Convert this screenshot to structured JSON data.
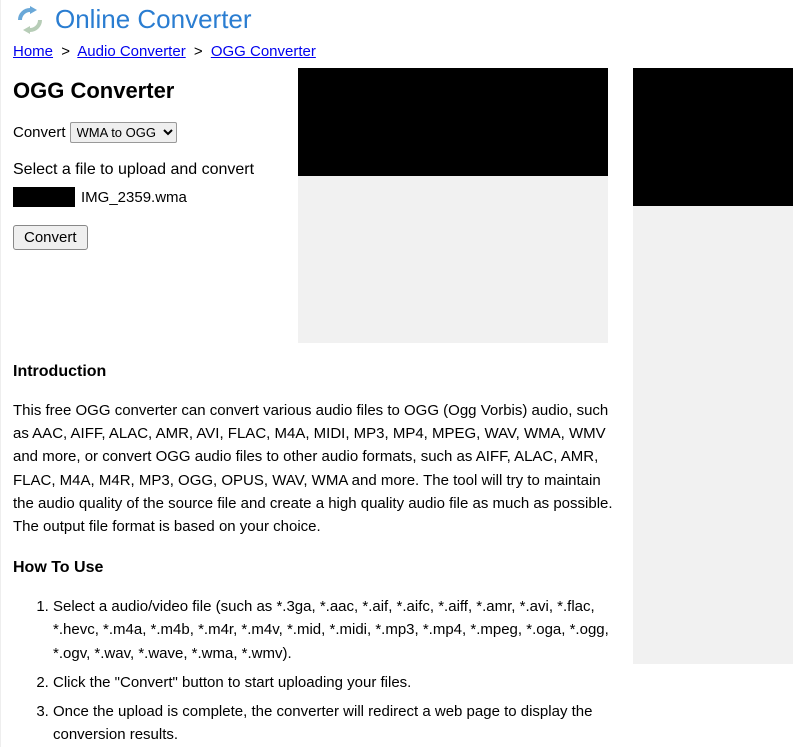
{
  "site": {
    "title": "Online Converter"
  },
  "breadcrumb": {
    "home": "Home",
    "audio": "Audio Converter",
    "ogg": "OGG Converter",
    "sep": ">"
  },
  "page": {
    "title": "OGG Converter"
  },
  "form": {
    "convert_label": "Convert",
    "select_value": "WMA to OGG",
    "instruct": "Select a file to upload and convert",
    "filename": "IMG_2359.wma",
    "submit": "Convert"
  },
  "intro": {
    "heading": "Introduction",
    "body": "This free OGG converter can convert various audio files to OGG (Ogg Vorbis) audio, such as AAC, AIFF, ALAC, AMR, AVI, FLAC, M4A, MIDI, MP3, MP4, MPEG, WAV, WMA, WMV and more, or convert OGG audio files to other audio formats, such as AIFF, ALAC, AMR, FLAC, M4A, M4R, MP3, OGG, OPUS, WAV, WMA and more. The tool will try to maintain the audio quality of the source file and create a high quality audio file as much as possible. The output file format is based on your choice."
  },
  "howto": {
    "heading": "How To Use",
    "steps": [
      "Select a audio/video file (such as *.3ga, *.aac, *.aif, *.aifc, *.aiff, *.amr, *.avi, *.flac, *.hevc, *.m4a, *.m4b, *.m4r, *.m4v, *.mid, *.midi, *.mp3, *.mp4, *.mpeg, *.oga, *.ogg, *.ogv, *.wav, *.wave, *.wma, *.wmv).",
      "Click the \"Convert\" button to start uploading your files.",
      "Once the upload is complete, the converter will redirect a web page to display the conversion results."
    ]
  }
}
